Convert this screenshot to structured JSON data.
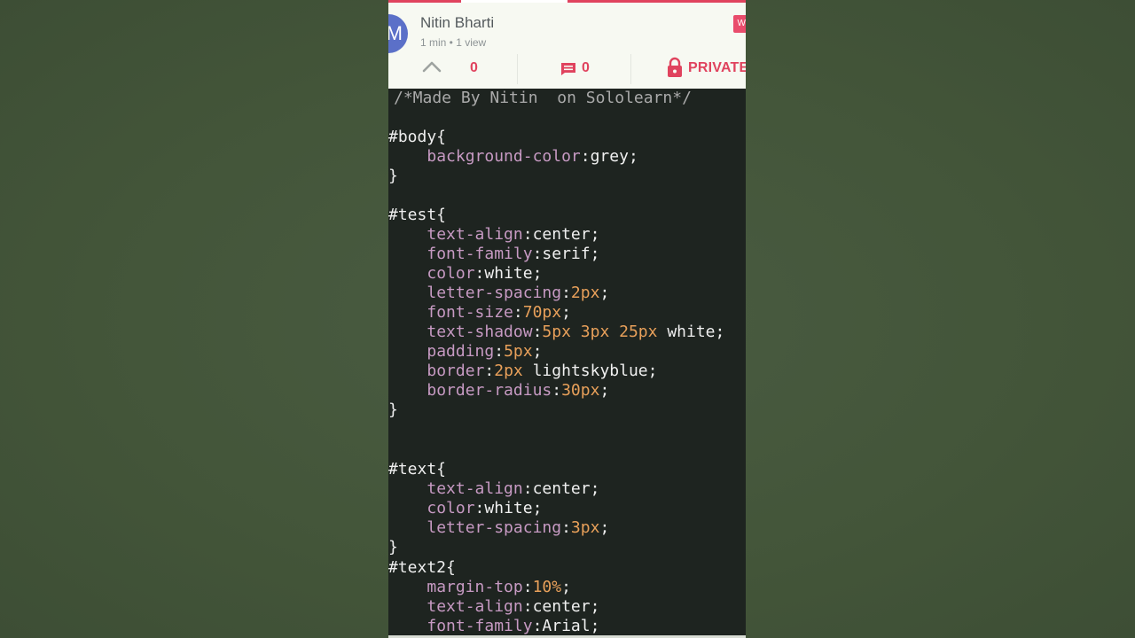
{
  "header": {
    "avatar_letter": "M",
    "author": "Nitin Bharti",
    "meta": "1 min • 1 view",
    "follow_badge": "W",
    "upvotes": "0",
    "comments": "0",
    "privacy_label": "PRIVATE"
  },
  "colors": {
    "accent": "#e0435e",
    "avatar": "#5b70c8",
    "code_bg": "#1e2420",
    "property": "#c79ac3",
    "number": "#e8a05a"
  },
  "code": {
    "line_1": "/*Made By Nitin  on Sololearn*/",
    "line_3": "#body{",
    "line_4_prop": "background-color",
    "line_4_val": "grey",
    "line_5": "}",
    "line_7": "#test{",
    "line_8_prop": "text-align",
    "line_8_val": "center",
    "line_9_prop": "font-family",
    "line_9_val": "serif",
    "line_10_prop": "color",
    "line_10_val": "white",
    "line_11_prop": "letter-spacing",
    "line_11_num": "2px",
    "line_12_prop": "font-size",
    "line_12_num": "70px",
    "line_13_prop": "text-shadow",
    "line_13_num": "5px 3px 25px",
    "line_13_val": "white",
    "line_14_prop": "padding",
    "line_14_num": "5px",
    "line_15_prop": "border",
    "line_15_num": "2px",
    "line_15_val": "lightskyblue",
    "line_16_prop": "border-radius",
    "line_16_num": "30px",
    "line_17": "}",
    "line_20": "#text{",
    "line_21_prop": "text-align",
    "line_21_val": "center",
    "line_22_prop": "color",
    "line_22_val": "white",
    "line_23_prop": "letter-spacing",
    "line_23_num": "3px",
    "line_24": "}",
    "line_25": "#text2{",
    "line_26_prop": "margin-top",
    "line_26_num": "10%",
    "line_27_prop": "text-align",
    "line_27_val": "center",
    "line_28_prop": "font-family",
    "line_28_val": "Arial"
  }
}
